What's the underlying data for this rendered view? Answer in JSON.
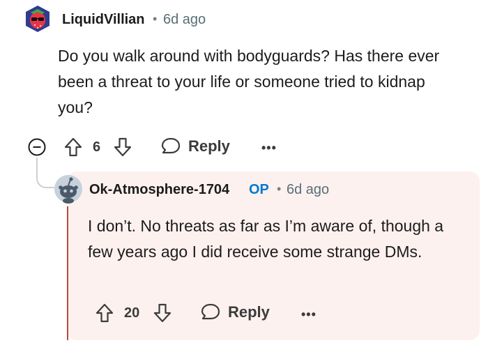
{
  "comment": {
    "username": "LiquidVillian",
    "time": "6d ago",
    "body": "Do you walk around with bodyguards? Has there ever been a threat to your life or someone tried to kidnap you?",
    "upvotes": "6",
    "reply_label": "Reply",
    "more_label": "•••"
  },
  "reply": {
    "username": "Ok-Atmosphere-1704",
    "op_badge": "OP",
    "time": "6d ago",
    "body": "I don’t. No threats as far as I’m aware of, though a few years ago I did receive some strange DMs.",
    "upvotes": "20",
    "reply_label": "Reply",
    "more_label": "•••"
  },
  "separator": "•",
  "colors": {
    "op_badge": "#0079d3",
    "reply_background": "#fdf1ef",
    "thread_line": "#b84a3a"
  }
}
